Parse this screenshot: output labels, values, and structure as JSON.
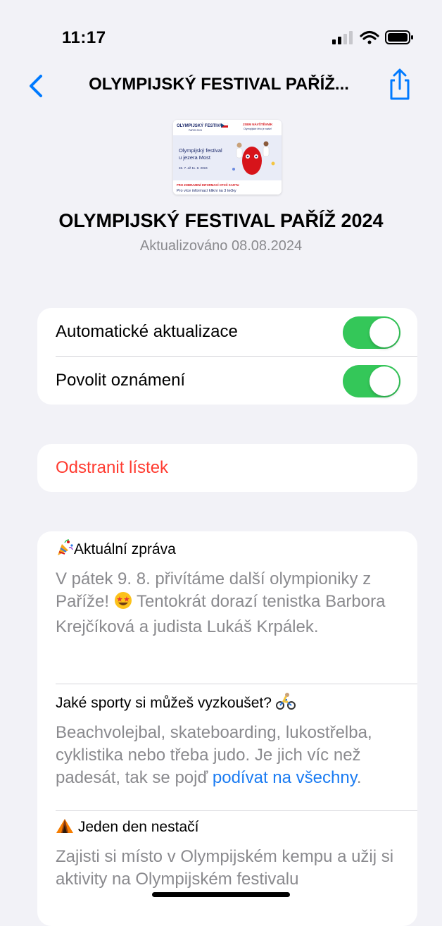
{
  "status_bar": {
    "time": "11:17"
  },
  "nav": {
    "title": "OLYMPIJSKÝ FESTIVAL PAŘÍŽ...",
    "back_icon": "chevron-left-icon",
    "share_icon": "share-icon"
  },
  "pass": {
    "thumbnail": {
      "header_left": "OLYMPIJSKÝ FESTIVAL",
      "header_sub": "PARIS 2024",
      "header_right_1": "JSEM NÁVŠTĚVNÍK",
      "header_right_2": "Olympijské léto je naše!",
      "headline_1": "Olympijský festival",
      "headline_2": "u jezera Most",
      "dates": "26. 7. až 11. 8. 2024",
      "footer_1": "PRO ZOBRAZENÍ INFORMACÍ OTOČ KARTU",
      "footer_2": "Pro více informací klikni na 3 tečky"
    },
    "title": "OLYMPIJSKÝ FESTIVAL PAŘÍŽ 2024",
    "updated": "Aktualizováno 08.08.2024"
  },
  "settings": {
    "auto_update_label": "Automatické aktualizace",
    "auto_update_on": true,
    "notifications_label": "Povolit oznámení",
    "notifications_on": true,
    "switch_color": "#34c759"
  },
  "remove": {
    "label": "Odstranit lístek",
    "color": "#ff3b30"
  },
  "info": {
    "news_title": "Aktuální zpráva",
    "news_body_1": "V pátek 9. 8. přivítáme další olympioniky z Paříže! ",
    "news_body_2": " Tentokrát dorazí tenistka Barbora Krejčíková a judista Lukáš Krpálek.",
    "sports_title": "Jaké sporty si můžeš vyzkoušet? ",
    "sports_body": "Beachvolejbal, skateboarding, lukostřelba, cyklistika nebo třeba judo. Je jich víc než padesát, tak se pojď ",
    "sports_link": "podívat na všechny",
    "sports_end": ".",
    "camp_title": " Jeden den nestačí",
    "camp_body": "Zajisti si místo v Olympijském kempu a užij si aktivity na Olympijském festivalu",
    "link_color": "#1a7bf2"
  }
}
